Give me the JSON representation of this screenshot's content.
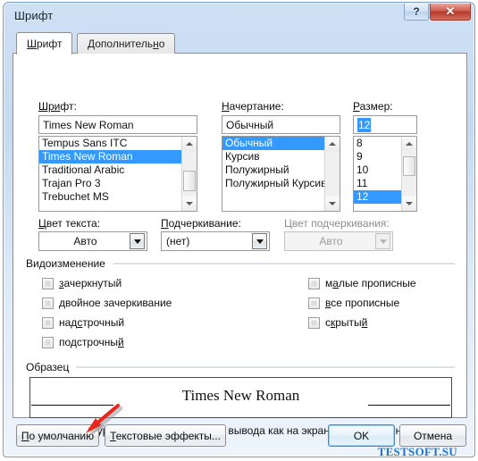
{
  "window": {
    "title": "Шрифт",
    "help_button": "?",
    "close_button": "✕"
  },
  "tabs": [
    {
      "label": "Шрифт",
      "accel": "Ш",
      "active": true
    },
    {
      "label": "Дополнительно",
      "accel": "н",
      "active": false
    }
  ],
  "font_section": {
    "font_label": "Шрифт:",
    "font_value": "Times New Roman",
    "font_items": [
      "Tempus Sans ITC",
      "Times New Roman",
      "Traditional Arabic",
      "Trajan Pro 3",
      "Trebuchet MS"
    ],
    "font_selected_index": 1,
    "style_label": "Начертание:",
    "style_value": "Обычный",
    "style_items": [
      "Обычный",
      "Курсив",
      "Полужирный",
      "Полужирный Курсив"
    ],
    "style_selected_index": 0,
    "size_label": "Размер:",
    "size_value": "12",
    "size_items": [
      "8",
      "9",
      "10",
      "11",
      "12"
    ],
    "size_selected_index": 4
  },
  "color_section": {
    "text_color_label": "Цвет текста:",
    "text_color_value": "Авто",
    "underline_label": "Подчеркивание:",
    "underline_value": "(нет)",
    "underline_color_label": "Цвет подчеркивания:",
    "underline_color_value": "Авто",
    "underline_color_disabled": true
  },
  "effects": {
    "group_label": "Видоизменение",
    "left_column": [
      {
        "label": "зачеркнутый",
        "checked": false
      },
      {
        "label": "двойное зачеркивание",
        "checked": false
      },
      {
        "label": "надстрочный",
        "checked": false
      },
      {
        "label": "подстрочный",
        "checked": false
      }
    ],
    "right_column": [
      {
        "label": "малые прописные",
        "checked": false
      },
      {
        "label": "все прописные",
        "checked": false
      },
      {
        "label": "скрытый",
        "checked": false
      }
    ]
  },
  "preview": {
    "group_label": "Образец",
    "sample_text": "Times New Roman",
    "note": "Шрифт TrueType. Он используется для вывода как на экран, так и на принтер."
  },
  "watermark": "TESTSOFT.SU",
  "footer": {
    "default_button": "По умолчанию",
    "default_accel": "П",
    "text_effects_button": "Текстовые эффекты...",
    "text_effects_accel": "Т",
    "ok_button": "OK",
    "cancel_button": "Отмена"
  },
  "annotation": {
    "type": "red-arrow",
    "points_to": "По умолчанию",
    "color": "#e8271c"
  }
}
